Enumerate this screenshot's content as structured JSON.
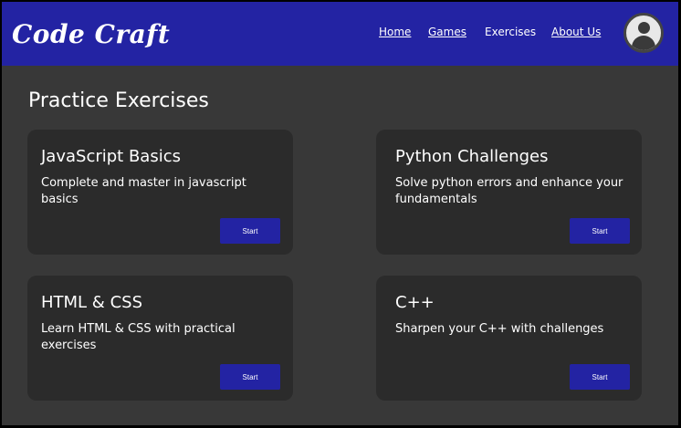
{
  "header": {
    "logo": "Code Craft",
    "nav": [
      {
        "label": "Home"
      },
      {
        "label": "Games"
      },
      {
        "label": "Exercises"
      },
      {
        "label": "About Us"
      }
    ]
  },
  "main": {
    "title": "Practice Exercises",
    "cards": [
      {
        "title": "JavaScript Basics",
        "description": "Complete and master in javascript basics",
        "button": "Start"
      },
      {
        "title": "Python Challenges",
        "description": "Solve python errors and enhance your fundamentals",
        "button": "Start"
      },
      {
        "title": "HTML & CSS",
        "description": "Learn HTML & CSS with practical exercises",
        "button": "Start"
      },
      {
        "title": "C++",
        "description": "Sharpen your C++ with challenges",
        "button": "Start"
      }
    ]
  },
  "colors": {
    "header": "#2323a3",
    "background": "#383838",
    "card": "#2b2b2b",
    "button": "#2323a3"
  }
}
